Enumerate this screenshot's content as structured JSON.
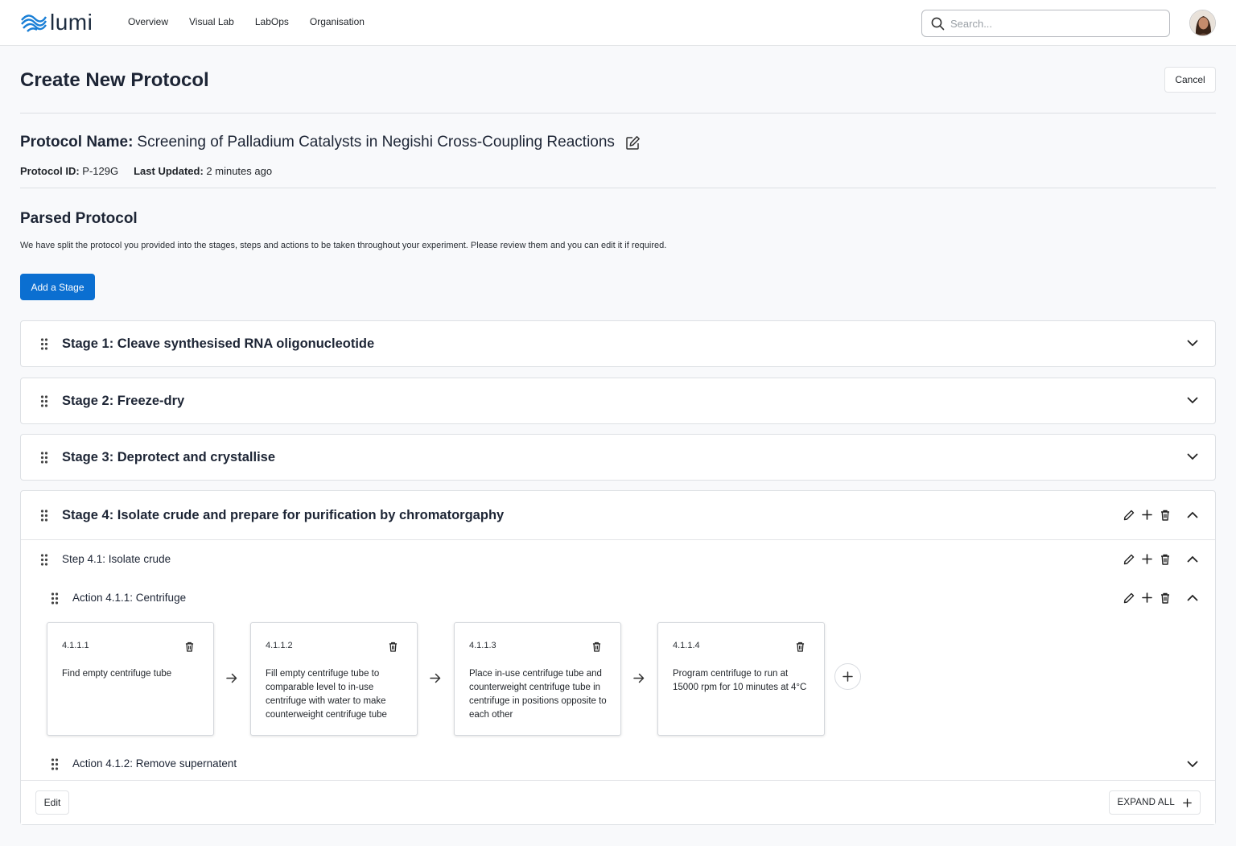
{
  "app": {
    "name": "lumi"
  },
  "nav": {
    "items": [
      "Overview",
      "Visual Lab",
      "LabOps",
      "Organisation"
    ]
  },
  "search": {
    "placeholder": "Search..."
  },
  "page": {
    "title": "Create New Protocol",
    "cancel_label": "Cancel"
  },
  "protocol": {
    "name_label": "Protocol Name:",
    "name": "Screening of Palladium Catalysts in Negishi Cross-Coupling Reactions",
    "id_label": "Protocol ID:",
    "id": "P-129G",
    "updated_label": "Last Updated:",
    "updated": "2 minutes ago"
  },
  "parsed": {
    "title": "Parsed Protocol",
    "description": "We have split the protocol you provided into the stages, steps and actions to be taken throughout your experiment. Please review them and you can edit it if required.",
    "add_stage_label": "Add a Stage"
  },
  "stages": [
    {
      "title": "Stage 1: Cleave synthesised RNA oligonucleotide"
    },
    {
      "title": "Stage 2: Freeze-dry"
    },
    {
      "title": "Stage 3: Deprotect and crystallise"
    },
    {
      "title": "Stage 4: Isolate crude and prepare for purification by chromatorgaphy"
    }
  ],
  "step": {
    "title": "Step 4.1: Isolate crude"
  },
  "actions": [
    {
      "title": "Action 4.1.1: Centrifuge"
    },
    {
      "title": "Action 4.1.2: Remove supernatent"
    }
  ],
  "cards": [
    {
      "num": "4.1.1.1",
      "text": "Find empty centrifuge tube"
    },
    {
      "num": "4.1.1.2",
      "text": "Fill empty centrifuge tube to comparable level to in-use centrifuge with water to make counterweight centrifuge tube"
    },
    {
      "num": "4.1.1.3",
      "text": "Place in-use centrifuge tube and counterweight centrifuge tube in centrifuge in positions opposite to each other"
    },
    {
      "num": "4.1.1.4",
      "text": "Program centrifuge to run at 15000 rpm for 10 minutes at 4°C"
    }
  ],
  "footer": {
    "edit_label": "Edit",
    "expand_label": "EXPAND ALL"
  },
  "colors": {
    "primary": "#0b6fd1",
    "text": "#1d2535",
    "logo": "#1a7fd6"
  }
}
